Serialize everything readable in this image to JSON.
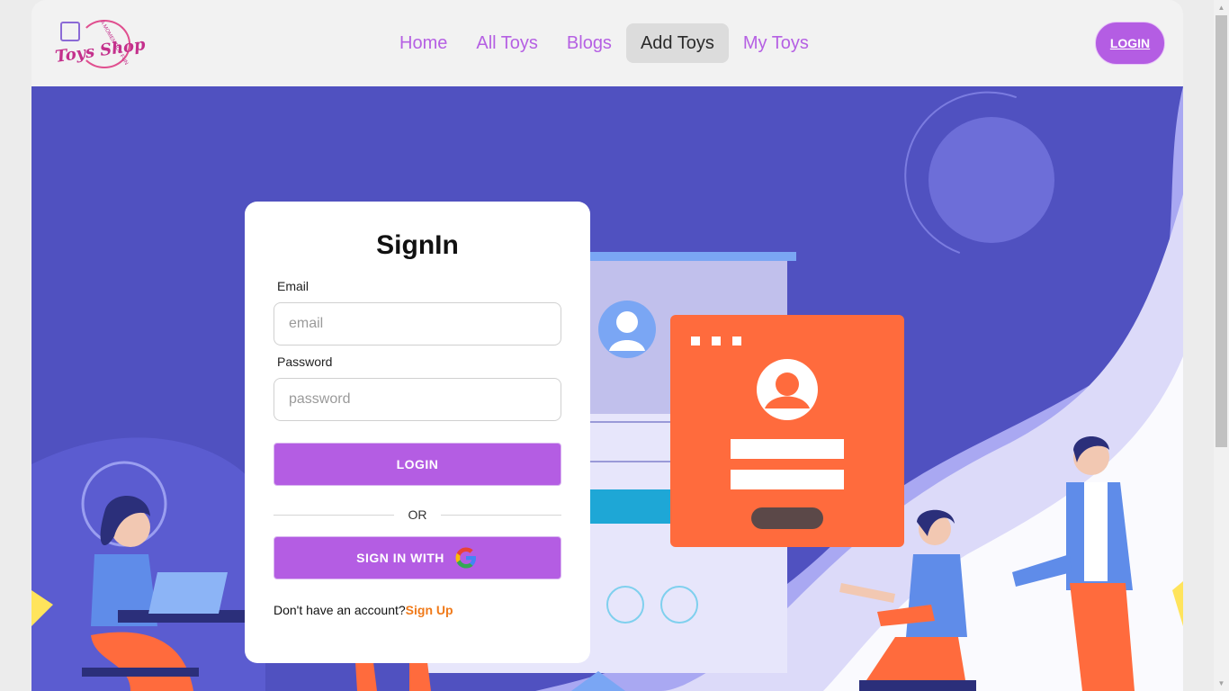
{
  "brand": {
    "logo_text": "Toys Shop",
    "logo_tagline": "A MOMENT OF FUN"
  },
  "nav": {
    "items": [
      {
        "label": "Home",
        "active": false
      },
      {
        "label": "All Toys",
        "active": false
      },
      {
        "label": "Blogs",
        "active": false
      },
      {
        "label": "Add Toys",
        "active": true
      },
      {
        "label": "My Toys",
        "active": false
      }
    ],
    "login_label": "LOGIN"
  },
  "signin": {
    "title": "SignIn",
    "email_label": "Email",
    "email_placeholder": "email",
    "password_label": "Password",
    "password_placeholder": "password",
    "login_button": "LOGIN",
    "or_text": "OR",
    "google_button": "SIGN IN WITH",
    "no_account_text": "Don't have an account?",
    "signup_link": "Sign Up"
  },
  "colors": {
    "accent": "#b45de3",
    "hero_bg": "#5051c0",
    "signup_link": "#f07a1a",
    "illustration_card": "#ff6b3d"
  }
}
